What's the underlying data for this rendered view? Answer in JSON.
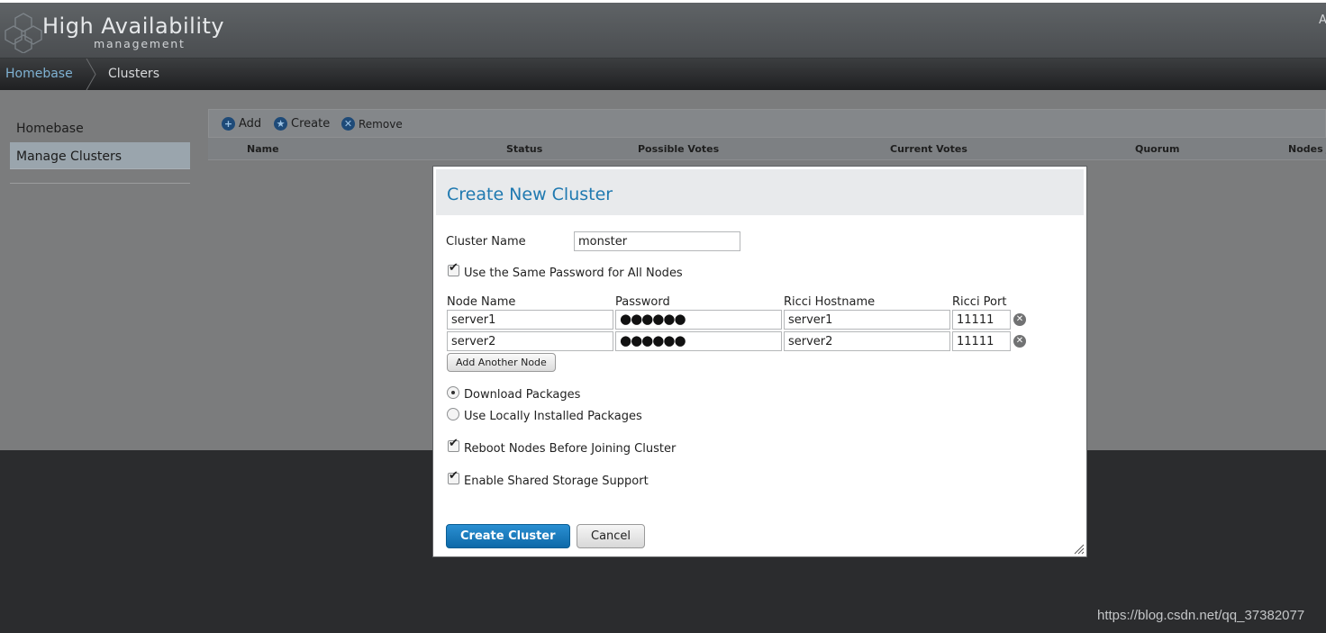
{
  "header": {
    "brand_title": "High Availability",
    "brand_subtitle": "management",
    "right_text": "A"
  },
  "breadcrumb": [
    "Homebase",
    "Clusters"
  ],
  "sidebar": {
    "items": [
      {
        "label": "Homebase",
        "selected": false
      },
      {
        "label": "Manage Clusters",
        "selected": true
      }
    ]
  },
  "toolbar": {
    "add_label": "Add",
    "create_label": "Create",
    "remove_label": "Remove"
  },
  "table": {
    "columns": [
      "Name",
      "Status",
      "Possible Votes",
      "Current Votes",
      "Quorum",
      "Nodes J"
    ]
  },
  "dialog": {
    "title": "Create New Cluster",
    "cluster_name_label": "Cluster Name",
    "cluster_name_value": "monster",
    "same_password_label": "Use the Same Password for All Nodes",
    "same_password_checked": true,
    "node_columns": {
      "node_name": "Node Name",
      "password": "Password",
      "ricci_hostname": "Ricci Hostname",
      "ricci_port": "Ricci Port"
    },
    "nodes": [
      {
        "name": "server1",
        "password": "●●●●●●",
        "hostname": "server1",
        "port": "11111"
      },
      {
        "name": "server2",
        "password": "●●●●●●",
        "hostname": "server2",
        "port": "11111"
      }
    ],
    "add_node_label": "Add Another Node",
    "download_packages_label": "Download Packages",
    "download_packages_selected": true,
    "local_packages_label": "Use Locally Installed Packages",
    "local_packages_selected": false,
    "reboot_label": "Reboot Nodes Before Joining Cluster",
    "reboot_checked": true,
    "shared_storage_label": "Enable Shared Storage Support",
    "shared_storage_checked": true,
    "create_label": "Create Cluster",
    "cancel_label": "Cancel"
  },
  "watermark": "https://blog.csdn.net/qq_37382077",
  "colors": {
    "accent": "#1f79b0",
    "primary_button": "#0d69a8",
    "link": "#7fb2d3"
  }
}
